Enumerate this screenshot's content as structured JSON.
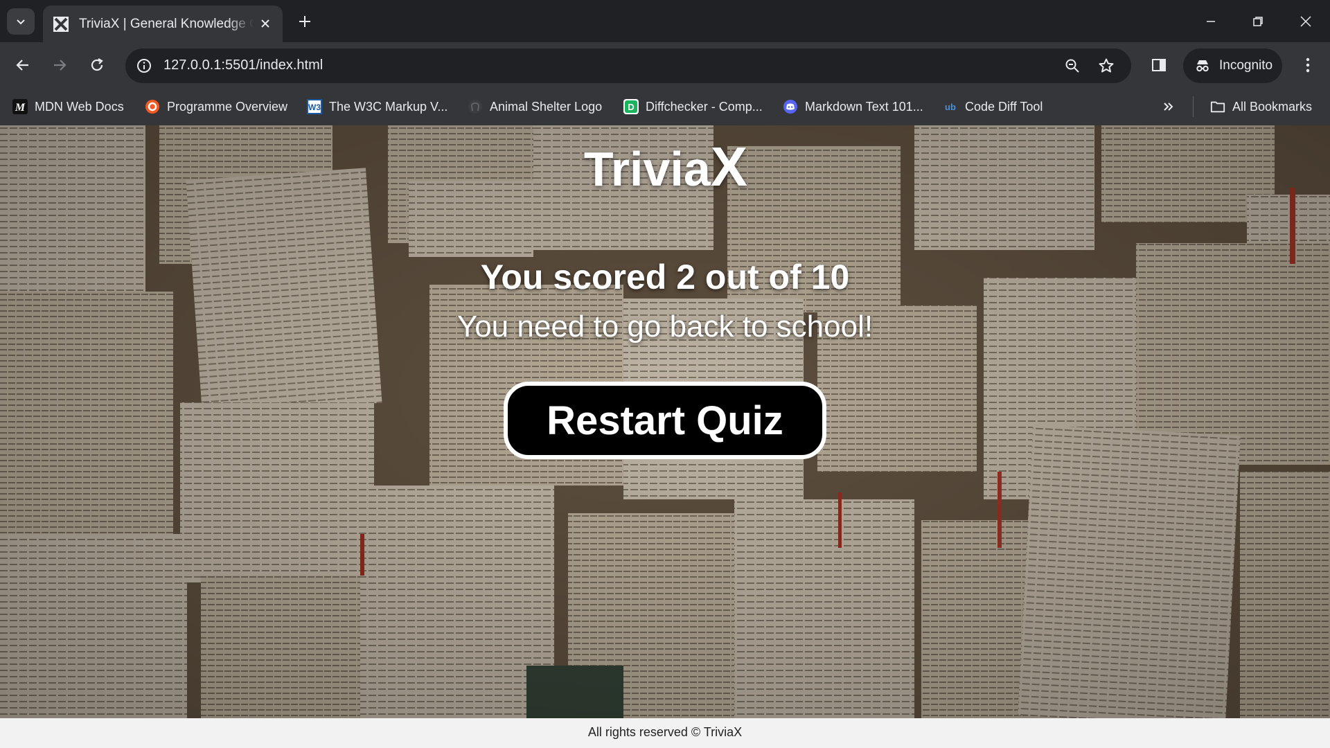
{
  "browser": {
    "tab": {
      "title": "TriviaX | General Knowledge Quiz",
      "favicon": "triviax-favicon-icon"
    },
    "address": {
      "url": "127.0.0.1:5501/index.html"
    },
    "incognito_label": "Incognito",
    "bookmarks": [
      {
        "label": "MDN Web Docs",
        "icon": "mdn-icon"
      },
      {
        "label": "Programme Overview",
        "icon": "orange-circle-icon"
      },
      {
        "label": "The W3C Markup V...",
        "icon": "w3c-icon"
      },
      {
        "label": "Animal Shelter Logo",
        "icon": "github-icon"
      },
      {
        "label": "Diffchecker - Comp...",
        "icon": "diffchecker-icon"
      },
      {
        "label": "Markdown Text 101...",
        "icon": "discord-icon"
      },
      {
        "label": "Code Diff Tool",
        "icon": "code-diff-icon"
      }
    ],
    "all_bookmarks_label": "All Bookmarks"
  },
  "page": {
    "logo": {
      "main": "Trivia",
      "accent": "X"
    },
    "result": {
      "score_text": "You scored 2 out of 10",
      "message": "You need to go back to school!"
    },
    "restart_label": "Restart Quiz",
    "footer": "All rights reserved © TriviaX"
  },
  "colors": {
    "chrome_dark": "#202124",
    "chrome_toolbar": "#35363a",
    "button_bg": "#000000",
    "button_border": "#ffffff",
    "footer_bg": "#f2f2f2"
  }
}
